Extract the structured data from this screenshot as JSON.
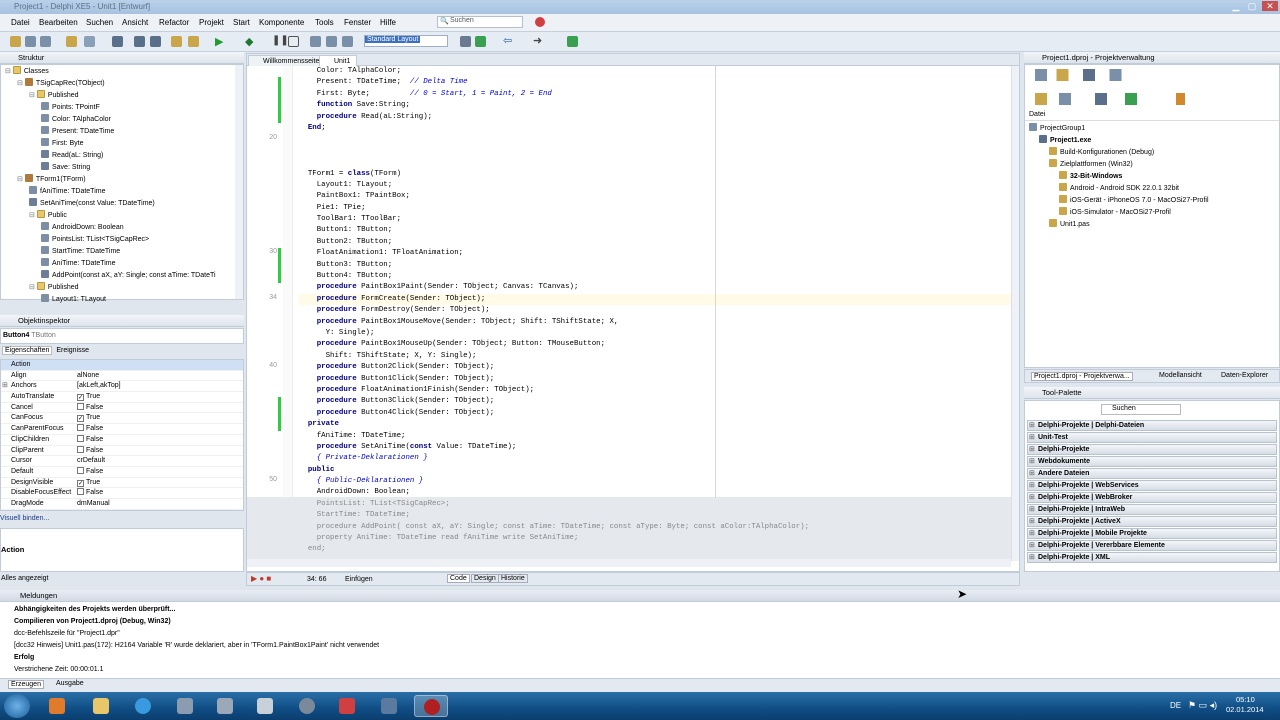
{
  "window": {
    "title": "Project1 - Delphi XE5 - Unit1 [Entwurf]"
  },
  "menu": [
    "Datei",
    "Bearbeiten",
    "Suchen",
    "Ansicht",
    "Refactor",
    "Projekt",
    "Start",
    "Komponente",
    "Tools",
    "Fenster",
    "Hilfe"
  ],
  "search": {
    "placeholder": "Suchen"
  },
  "toolbar": {
    "layout": "Standard Layout"
  },
  "structure": {
    "title": "Struktur",
    "items": [
      {
        "label": "Classes",
        "d": 0,
        "i": "fold"
      },
      {
        "label": "TSigCapRec(TObject)",
        "d": 1,
        "i": "cls"
      },
      {
        "label": "Published",
        "d": 2,
        "i": "fold"
      },
      {
        "label": "Points: TPointF",
        "d": 3,
        "i": "prop"
      },
      {
        "label": "Color: TAlphaColor",
        "d": 3,
        "i": "prop"
      },
      {
        "label": "Present: TDateTime",
        "d": 3,
        "i": "prop"
      },
      {
        "label": "First: Byte",
        "d": 3,
        "i": "prop"
      },
      {
        "label": "Read(aL: String)",
        "d": 3,
        "i": "meth"
      },
      {
        "label": "Save: String",
        "d": 3,
        "i": "meth"
      },
      {
        "label": "TForm1(TForm)",
        "d": 1,
        "i": "cls"
      },
      {
        "label": "fAniTime: TDateTime",
        "d": 2,
        "i": "prop"
      },
      {
        "label": "SetAniTime(const Value: TDateTime)",
        "d": 2,
        "i": "meth"
      },
      {
        "label": "Public",
        "d": 2,
        "i": "fold"
      },
      {
        "label": "AndroidDown: Boolean",
        "d": 3,
        "i": "prop"
      },
      {
        "label": "PointsList: TList<TSigCapRec>",
        "d": 3,
        "i": "prop"
      },
      {
        "label": "StartTime: TDateTime",
        "d": 3,
        "i": "prop"
      },
      {
        "label": "AniTime: TDateTime",
        "d": 3,
        "i": "prop"
      },
      {
        "label": "AddPoint(const aX, aY: Single; const aTime: TDateTi",
        "d": 3,
        "i": "meth"
      },
      {
        "label": "Published",
        "d": 2,
        "i": "fold"
      },
      {
        "label": "Layout1: TLayout",
        "d": 3,
        "i": "prop"
      }
    ]
  },
  "inspector": {
    "title": "Objektinspektor",
    "object": "Button4",
    "object_type": "TButton",
    "tabs": [
      "Eigenschaften",
      "Ereignisse"
    ],
    "rows": [
      {
        "name": "Action",
        "value": ""
      },
      {
        "name": "Align",
        "value": "alNone"
      },
      {
        "name": "Anchors",
        "value": "[akLeft,akTop]"
      },
      {
        "name": "AutoTranslate",
        "value": "True",
        "check": "✓"
      },
      {
        "name": "Cancel",
        "value": "False",
        "check": ""
      },
      {
        "name": "CanFocus",
        "value": "True",
        "check": "✓"
      },
      {
        "name": "CanParentFocus",
        "value": "False",
        "check": ""
      },
      {
        "name": "ClipChildren",
        "value": "False",
        "check": ""
      },
      {
        "name": "ClipParent",
        "value": "False",
        "check": ""
      },
      {
        "name": "Cursor",
        "value": "crDefault"
      },
      {
        "name": "Default",
        "value": "False",
        "check": ""
      },
      {
        "name": "DesignVisible",
        "value": "True",
        "check": "✓"
      },
      {
        "name": "DisableFocusEffect",
        "value": "False",
        "check": ""
      },
      {
        "name": "DragMode",
        "value": "dmManual"
      }
    ],
    "bindings": "Visuell binden...",
    "desc_title": "Action",
    "status": "Alles angezeigt"
  },
  "editor": {
    "tabs": [
      "Willkommensseite",
      "Unit1"
    ],
    "gutter": [
      {
        "n": "20",
        "row": 6
      },
      {
        "n": "30",
        "row": 16
      },
      {
        "n": "34",
        "row": 20
      },
      {
        "n": "40",
        "row": 26
      },
      {
        "n": "50",
        "row": 36
      }
    ],
    "lines": [
      "    Color: TAlphaColor;",
      "    Present: TDateTime;  // Delta Time",
      "    First: Byte;         // 0 = Start, 1 = Paint, 2 = End",
      "    function Save:String;",
      "    procedure Read(aL:String);",
      "  End;",
      "",
      "",
      "",
      "  TForm1 = class(TForm)",
      "    Layout1: TLayout;",
      "    PaintBox1: TPaintBox;",
      "    Pie1: TPie;",
      "    ToolBar1: TToolBar;",
      "    Button1: TButton;",
      "    Button2: TButton;",
      "    FloatAnimation1: TFloatAnimation;",
      "    Button3: TButton;",
      "    Button4: TButton;",
      "    procedure PaintBox1Paint(Sender: TObject; Canvas: TCanvas);",
      "    procedure FormCreate(Sender: TObject);",
      "    procedure FormDestroy(Sender: TObject);",
      "    procedure PaintBox1MouseMove(Sender: TObject; Shift: TShiftState; X,",
      "      Y: Single);",
      "    procedure PaintBox1MouseUp(Sender: TObject; Button: TMouseButton;",
      "      Shift: TShiftState; X, Y: Single);",
      "    procedure Button2Click(Sender: TObject);",
      "    procedure Button1Click(Sender: TObject);",
      "    procedure FloatAnimation1Finish(Sender: TObject);",
      "    procedure Button3Click(Sender: TObject);",
      "    procedure Button4Click(Sender: TObject);",
      "  private",
      "    fAniTime: TDateTime;",
      "    procedure SetAniTime(const Value: TDateTime);",
      "    { Private-Deklarationen }",
      "  public",
      "    { Public-Deklarationen }",
      "    AndroidDown: Boolean;",
      "    PointsList: TList<TSigCapRec>;",
      "    StartTime: TDateTime;",
      "    procedure AddPoint( const aX, aY: Single; const aTime: TDateTime; const aType: Byte; const aColor:TAlphaColor);",
      "    property AniTime: TDateTime read fAniTime write SetAniTime;",
      "  end;"
    ],
    "status": {
      "pos": "34: 66",
      "mode": "Einfügen"
    },
    "bottom_tabs": [
      "Code",
      "Design",
      "Historie"
    ]
  },
  "project": {
    "title": "Project1.dproj - Projektverwaltung",
    "col": "Datei",
    "items": [
      {
        "label": "ProjectGroup1",
        "d": 0,
        "b": false
      },
      {
        "label": "Project1.exe",
        "d": 1,
        "b": true
      },
      {
        "label": "Build-Konfigurationen (Debug)",
        "d": 2,
        "b": false
      },
      {
        "label": "Zielplattformen (Win32)",
        "d": 2,
        "b": false
      },
      {
        "label": "32-Bit-Windows",
        "d": 3,
        "b": true
      },
      {
        "label": "Android - Android SDK 22.0.1 32bit",
        "d": 3,
        "b": false
      },
      {
        "label": "iOS-Gerät - iPhoneOS 7.0 - MacOSi27-Profil",
        "d": 3,
        "b": false
      },
      {
        "label": "iOS-Simulator - MacOSi27-Profil",
        "d": 3,
        "b": false
      },
      {
        "label": "Unit1.pas",
        "d": 2,
        "b": false
      }
    ],
    "tabs": [
      "Project1.dproj - Projektverwa...",
      "Modellansicht",
      "Daten-Explorer"
    ]
  },
  "palette": {
    "title": "Tool-Palette",
    "search": "Suchen",
    "cats": [
      "Delphi-Projekte | Delphi-Dateien",
      "Unit-Test",
      "Delphi-Projekte",
      "Webdokumente",
      "Andere Dateien",
      "Delphi-Projekte | WebServices",
      "Delphi-Projekte | WebBroker",
      "Delphi-Projekte | IntraWeb",
      "Delphi-Projekte | ActiveX",
      "Delphi-Projekte | Mobile Projekte",
      "Delphi-Projekte | Vererbbare Elemente",
      "Delphi-Projekte | XML"
    ]
  },
  "messages": {
    "title": "Meldungen",
    "lines": [
      {
        "t": "Abhängigkeiten des Projekts werden überprüft...",
        "b": true
      },
      {
        "t": "Compilieren von Project1.dproj (Debug, Win32)",
        "b": true
      },
      {
        "t": "dcc-Befehlszeile für \"Project1.dpr\"",
        "b": false
      },
      {
        "t": "[dcc32 Hinweis] Unit1.pas(172): H2164 Variable 'R' wurde deklariert, aber in 'TForm1.PaintBox1Paint' nicht verwendet",
        "b": false
      },
      {
        "t": "Erfolg",
        "b": true
      },
      {
        "t": "Verstrichene Zeit: 00:00:01.1",
        "b": false
      }
    ],
    "tabs": [
      "Erzeugen",
      "Ausgabe"
    ]
  },
  "taskbar": {
    "lang": "DE",
    "time": "05:10",
    "date": "02.01.2014"
  }
}
